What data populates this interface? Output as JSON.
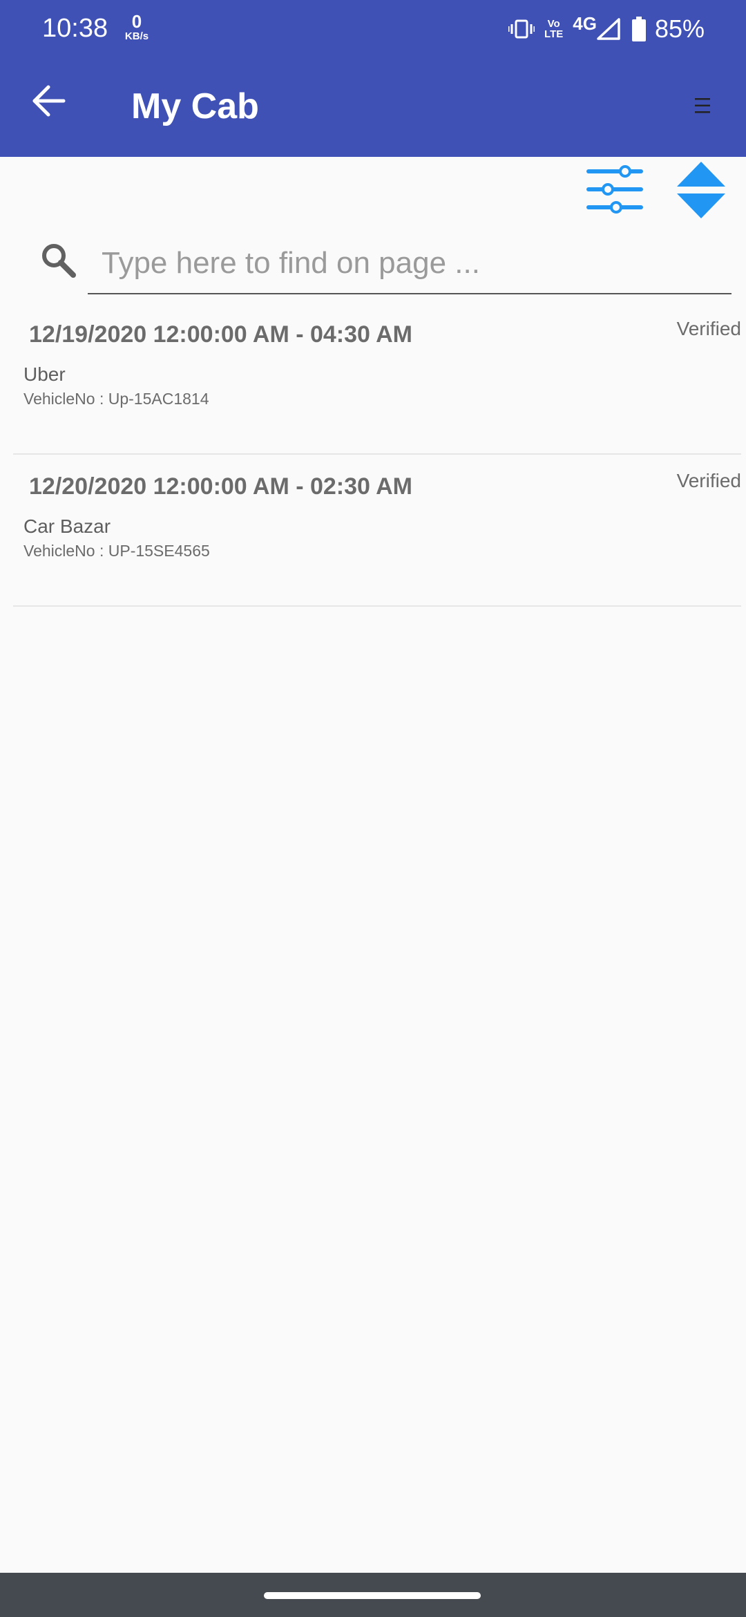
{
  "status_bar": {
    "time": "10:38",
    "net_speed_value": "0",
    "net_speed_unit": "KB/s",
    "volte_top": "Vo",
    "volte_bottom": "LTE",
    "network": "4G",
    "battery": "85%"
  },
  "app_bar": {
    "title": "My Cab",
    "back_icon": "arrow-left-icon",
    "menu_icon": "menu-icon",
    "color": "#3f51b5"
  },
  "toolbar": {
    "filter_icon": "sliders-icon",
    "sort_icon": "sort-up-down-icon",
    "icon_color": "#2196f3"
  },
  "search": {
    "placeholder": "Type here to find on page ...",
    "value": ""
  },
  "trips": [
    {
      "datetime": "12/19/2020 12:00:00 AM - 04:30 AM",
      "status": "Verified",
      "provider": "Uber",
      "vehicle": "VehicleNo : Up-15AC1814"
    },
    {
      "datetime": "12/20/2020 12:00:00 AM - 02:30 AM",
      "status": "Verified",
      "provider": "Car Bazar",
      "vehicle": "VehicleNo : UP-15SE4565"
    }
  ]
}
